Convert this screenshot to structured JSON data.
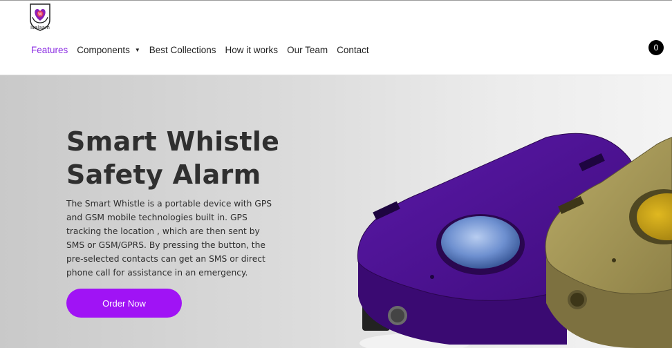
{
  "brand": {
    "logo_text": "Isalaam",
    "logo_icon": "heart-hands-logo"
  },
  "nav": {
    "items": [
      {
        "label": "Features",
        "active": true
      },
      {
        "label": "Components",
        "has_dropdown": true
      },
      {
        "label": "Best Collections"
      },
      {
        "label": "How it works"
      },
      {
        "label": "Our Team"
      },
      {
        "label": "Contact"
      }
    ],
    "cart_count": "0"
  },
  "hero": {
    "title_line1": "Smart Whistle",
    "title_line2": "Safety Alarm",
    "description": "The Smart Whistle is a portable device with GPS and GSM mobile technologies built in. GPS tracking the location , which are then sent by SMS or GSM/GPRS. By pressing the button, the pre-selected contacts can get an SMS or direct phone call for assistance in an emergency.",
    "cta_label": "Order Now",
    "image_icon": "smart-whistle-device-image"
  },
  "colors": {
    "accent": "#a013f5",
    "active_nav": "#8a2be2",
    "device_purple": "#4b0f8c",
    "device_gold": "#a89a55"
  }
}
